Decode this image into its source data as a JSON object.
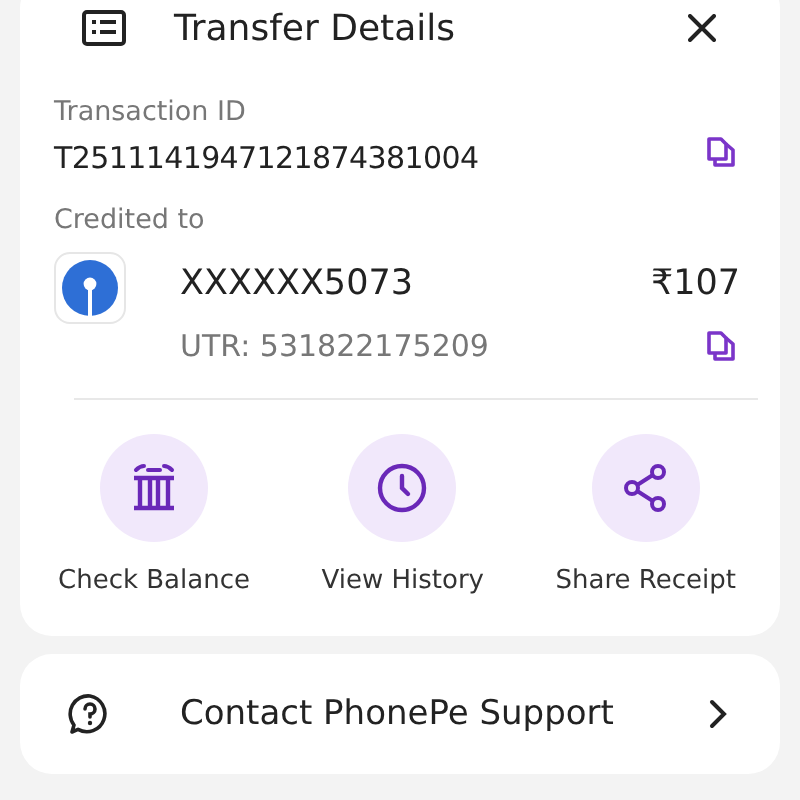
{
  "header": {
    "title": "Transfer Details"
  },
  "transaction": {
    "label": "Transaction ID",
    "value": "T2511141947121874381004"
  },
  "credited": {
    "label": "Credited to",
    "account": "XXXXXX5073",
    "amount": "₹107",
    "utr": "UTR: 531822175209"
  },
  "actions": [
    {
      "kind": "balance",
      "label": "Check Balance"
    },
    {
      "kind": "history",
      "label": "View History"
    },
    {
      "kind": "share",
      "label": "Share Receipt"
    }
  ],
  "support": {
    "label": "Contact PhonePe Support"
  }
}
